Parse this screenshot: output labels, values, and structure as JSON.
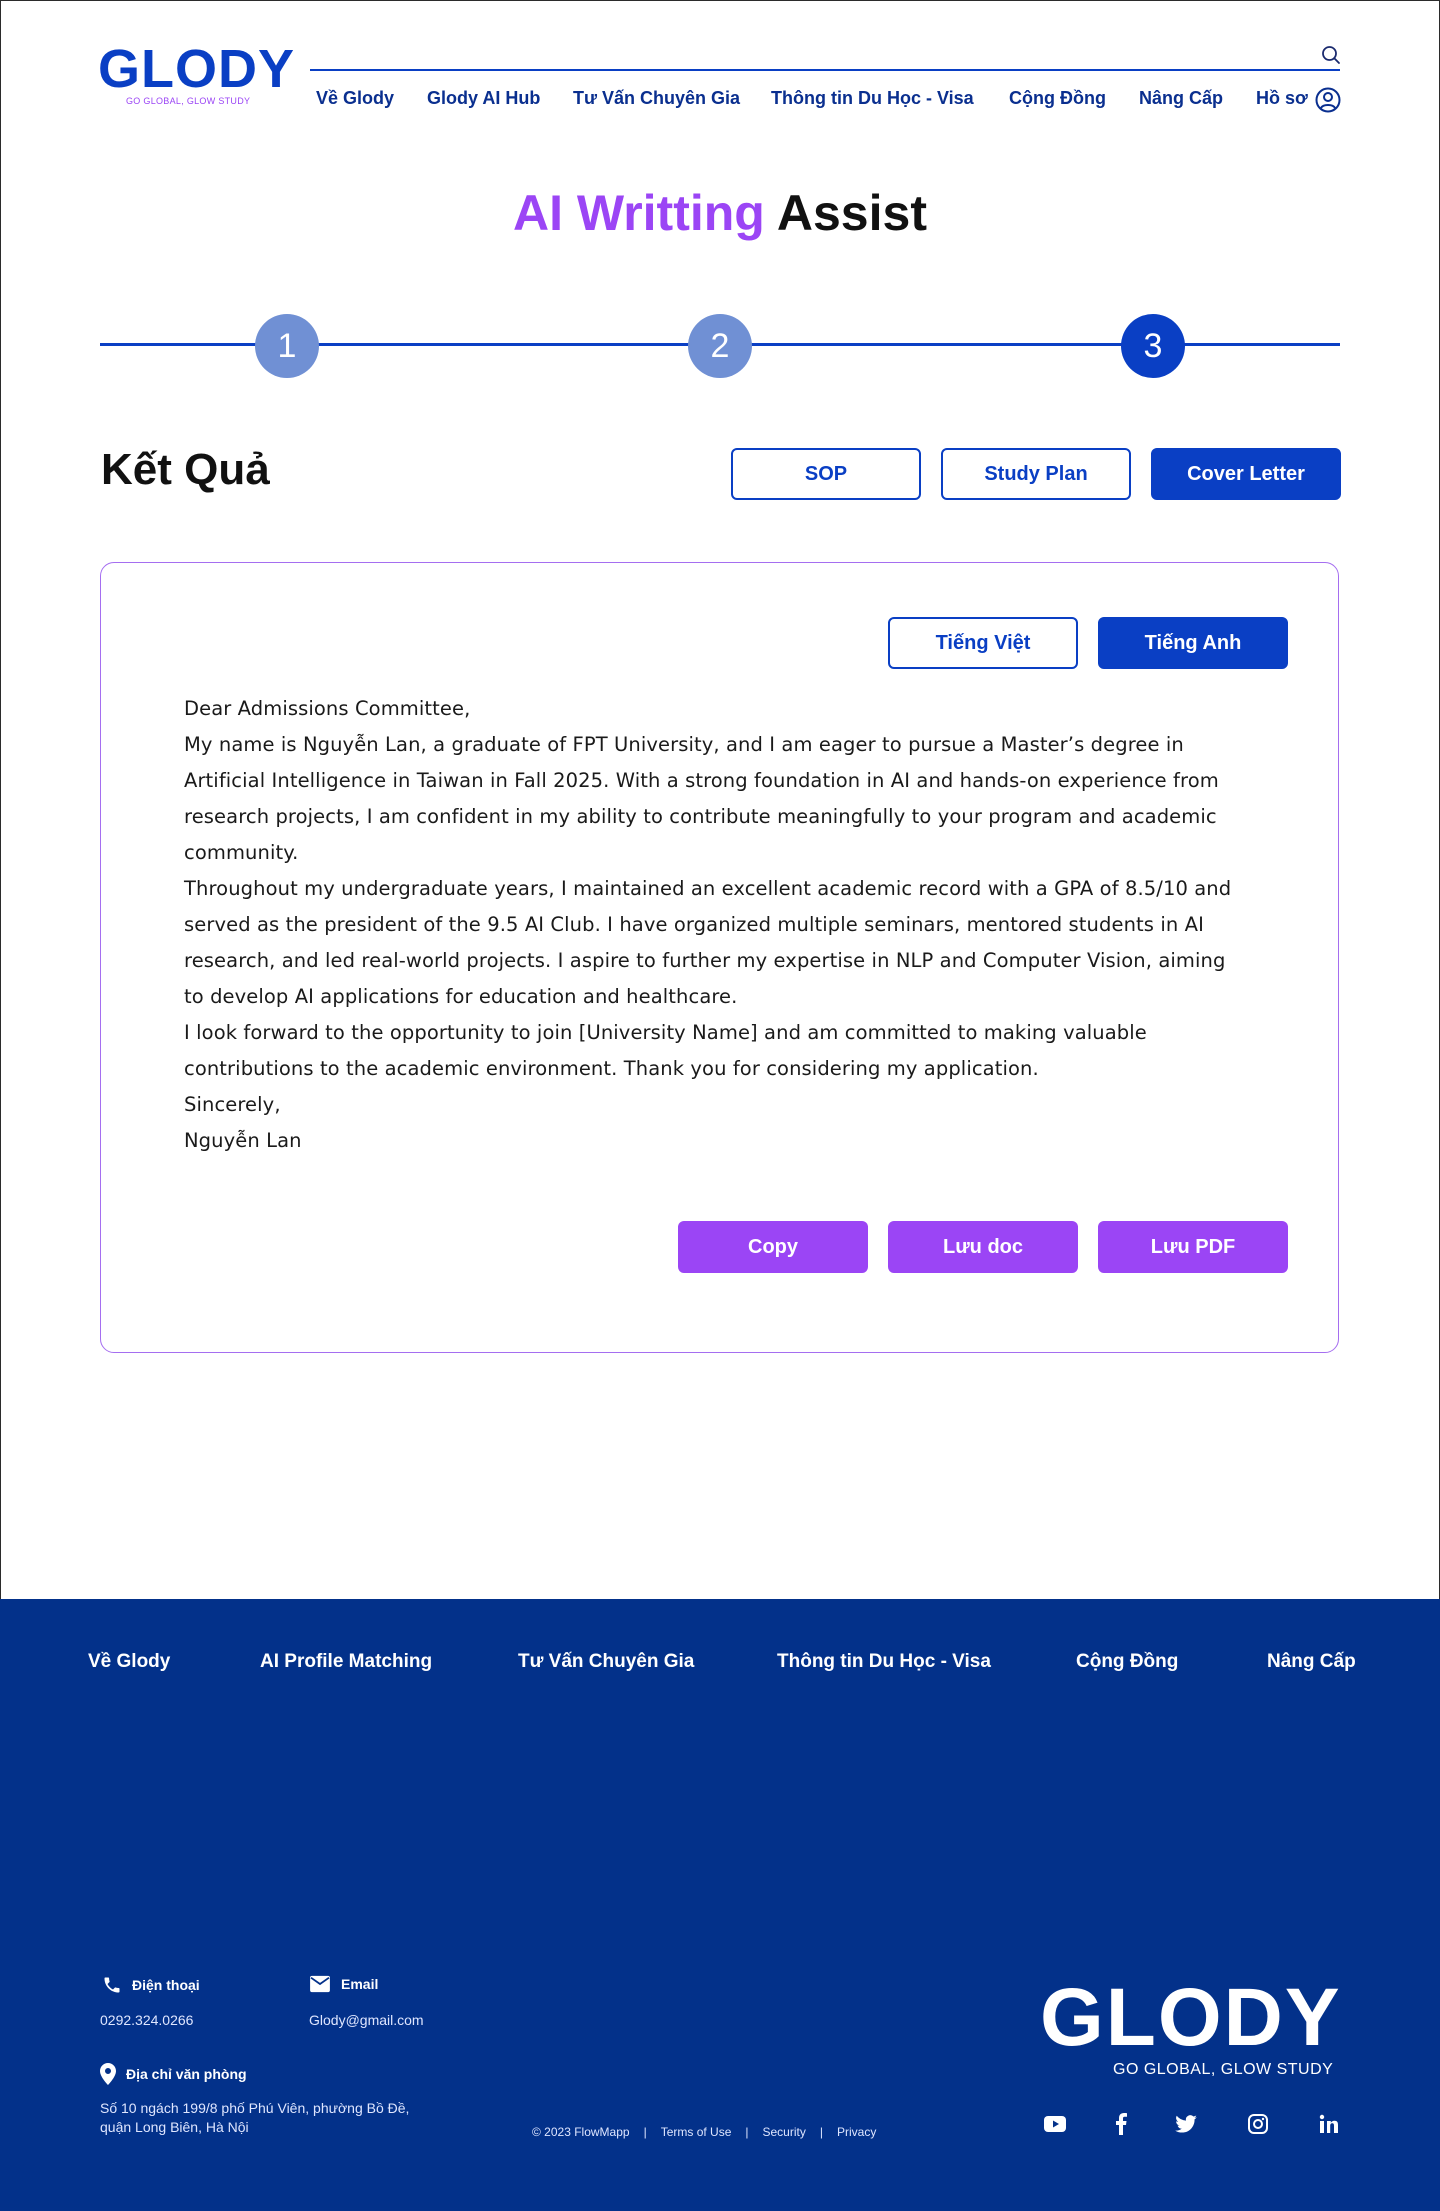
{
  "header": {
    "logo_text": "GLODY",
    "logo_tagline": "GO GLOBAL, GLOW STUDY",
    "nav": [
      "Về Glody",
      "Glody AI Hub",
      "Tư Vấn Chuyên Gia",
      "Thông tin Du Học - Visa",
      "Cộng Đồng",
      "Nâng Cấp",
      "Hồ sơ"
    ]
  },
  "title": {
    "accent": "AI Writting",
    "rest": "Assist"
  },
  "stepper": {
    "steps": [
      "1",
      "2",
      "3"
    ],
    "active": 3
  },
  "result": {
    "heading": "Kết Quả",
    "doc_tabs": [
      "SOP",
      "Study Plan",
      "Cover Letter"
    ],
    "selected_doc": "Cover Letter",
    "lang_tabs": [
      "Tiếng Việt",
      "Tiếng Anh"
    ],
    "selected_lang": "Tiếng Anh",
    "letter": [
      "Dear Admissions Committee,",
      "My name is Nguyễn Lan, a graduate of FPT University, and I am eager to pursue a Master’s degree in Artificial Intelligence in Taiwan in Fall 2025. With a strong foundation in AI and hands-on experience from research projects, I am confident in my ability to contribute meaningfully to your program and academic community.",
      "Throughout my undergraduate years, I maintained an excellent academic record with a GPA of 8.5/10 and served as the president of the 9.5 AI Club. I have organized multiple seminars, mentored students in AI research, and led real-world projects. I aspire to further my expertise in NLP and Computer Vision, aiming to develop AI applications for education and healthcare.",
      "I look forward to the opportunity to join [University Name] and am committed to making valuable contributions to the academic environment. Thank you for considering my application.",
      "Sincerely,",
      "Nguyễn Lan"
    ],
    "actions": [
      "Copy",
      "Lưu doc",
      "Lưu PDF"
    ]
  },
  "footer": {
    "nav": [
      "Về Glody",
      "AI Profile Matching",
      "Tư Vấn Chuyên Gia",
      "Thông tin Du Học - Visa",
      "Cộng Đồng",
      "Nâng Cấp"
    ],
    "phone_label": "Điện thoại",
    "phone": "0292.324.0266",
    "email_label": "Email",
    "email": "Glody@gmail.com",
    "address_label": "Địa chỉ văn phòng",
    "address": "Số 10 ngách 199/8 phố Phú Viên, phường Bồ Đề, quận Long Biên, Hà Nội",
    "copyright": "© 2023 FlowMapp",
    "links": [
      "Terms of Use",
      "Security",
      "Privacy"
    ],
    "logo_text": "GLODY",
    "logo_tagline": "GO GLOBAL, GLOW STUDY",
    "social": [
      "youtube-icon",
      "facebook-icon",
      "twitter-icon",
      "instagram-icon",
      "linkedin-icon"
    ]
  },
  "colors": {
    "brand_blue": "#0a3fc4",
    "accent_purple": "#9b45f5",
    "footer_blue": "#03318a",
    "step_done": "#7090d4"
  }
}
